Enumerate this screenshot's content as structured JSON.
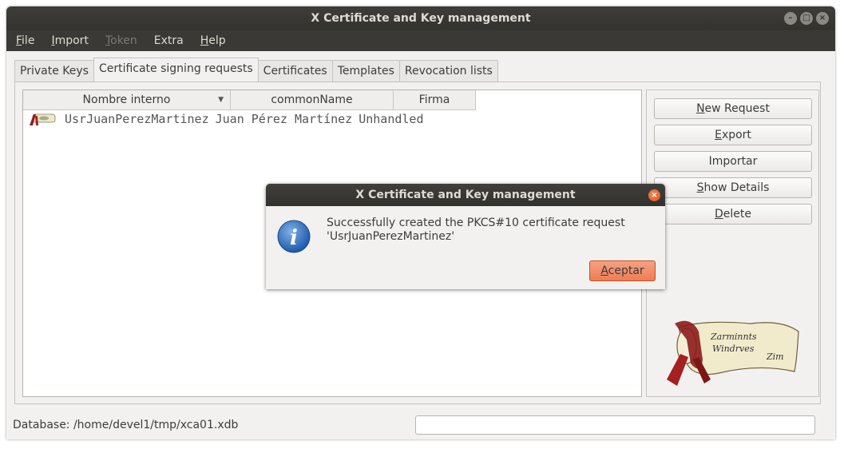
{
  "window": {
    "title": "X Certificate and Key management"
  },
  "menubar": {
    "items": [
      {
        "label": "File",
        "accel": "F",
        "rest": "ile",
        "enabled": true
      },
      {
        "label": "Import",
        "accel": "I",
        "rest": "mport",
        "enabled": true
      },
      {
        "label": "Token",
        "accel": "T",
        "rest": "oken",
        "enabled": false
      },
      {
        "label": "Extra",
        "accel": "",
        "rest": "Extra",
        "enabled": true
      },
      {
        "label": "Help",
        "accel": "H",
        "rest": "elp",
        "enabled": true
      }
    ]
  },
  "tabs": [
    {
      "label": "Private Keys",
      "active": false
    },
    {
      "label": "Certificate signing requests",
      "active": true
    },
    {
      "label": "Certificates",
      "active": false
    },
    {
      "label": "Templates",
      "active": false
    },
    {
      "label": "Revocation lists",
      "active": false
    }
  ],
  "table": {
    "columns": [
      "Nombre interno",
      "commonName",
      "Firma"
    ],
    "rows": [
      {
        "internal_name": "UsrJuanPerezMartinez",
        "common_name": "Juan Pérez Martínez",
        "signature": "Unhandled"
      }
    ]
  },
  "side_buttons": {
    "new_request": {
      "accel": "N",
      "rest": "ew Request"
    },
    "export": {
      "accel": "E",
      "rest": "xport"
    },
    "importar": {
      "label": "Importar"
    },
    "show_details": {
      "accel": "S",
      "rest": "how Details"
    },
    "delete": {
      "accel": "D",
      "rest": "elete"
    }
  },
  "logo": {
    "text_line1": "Zarminnts",
    "text_line2": "Windrves",
    "text_line3": "Zim"
  },
  "status": {
    "database": "Database: /home/devel1/tmp/xca01.xdb"
  },
  "dialog": {
    "title": "X Certificate and Key management",
    "message_line1": "Successfully created the PKCS#10 certificate request",
    "message_line2": "'UsrJuanPerezMartinez'",
    "button_accel": "A",
    "button_rest": "ceptar"
  },
  "colors": {
    "accent": "#ee7d55",
    "titlebar": "#3e3d39"
  }
}
